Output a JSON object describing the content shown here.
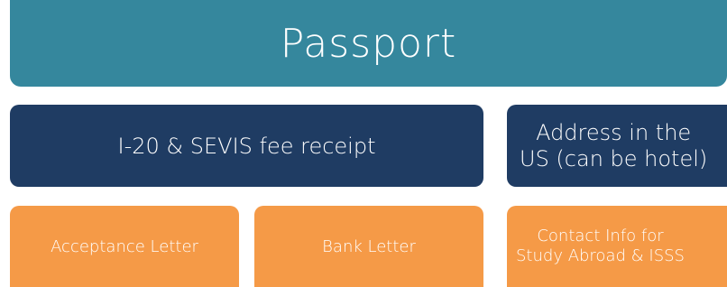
{
  "passport": {
    "label": "Passport"
  },
  "row2": {
    "i20_label": "I-20 & SEVIS fee receipt",
    "address_label": "Address in the\nUS (can be hotel)"
  },
  "row3": {
    "acceptance_label": "Acceptance Letter",
    "bank_label": "Bank Letter",
    "contact_label": "Contact Info for\nStudy Abroad  & ISSS"
  },
  "colors": {
    "teal": "#35879d",
    "navy": "#1f3c63",
    "orange": "#f59a47",
    "text": "#ffffff"
  }
}
